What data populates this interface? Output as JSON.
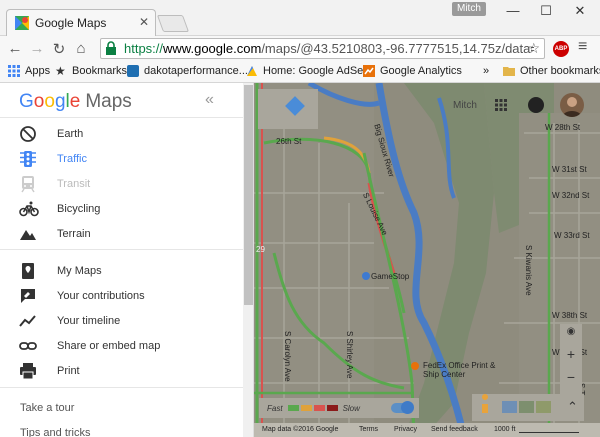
{
  "window": {
    "tab_title": "Google Maps",
    "user_badge": "Mitch",
    "controls": {
      "minimize": "—",
      "maximize": "☐",
      "close": "✕"
    }
  },
  "toolbar": {
    "url_scheme": "https://",
    "url_host": "www.google.com",
    "url_path": "/maps/@43.5210803,-96.7777515,14.75z/data=!5",
    "abp_label": "ABP"
  },
  "bookmarks": [
    {
      "label": "Apps",
      "icon": "apps-icon"
    },
    {
      "label": "Bookmarks",
      "icon": "star-icon"
    },
    {
      "label": "dakotaperformance...",
      "icon": "site-icon"
    },
    {
      "label": "Home: Google AdSe...",
      "icon": "adsense-icon"
    },
    {
      "label": "Google Analytics",
      "icon": "analytics-icon"
    },
    {
      "label": "Other bookmarks",
      "icon": "folder-icon"
    }
  ],
  "bookmarks_more": "»",
  "sidebar": {
    "brand_letters": [
      "G",
      "o",
      "o",
      "g",
      "l",
      "e"
    ],
    "brand_suffix": "Maps",
    "collapse": "«",
    "layers": [
      {
        "label": "Earth",
        "icon": "earth-icon",
        "state": "normal"
      },
      {
        "label": "Traffic",
        "icon": "traffic-icon",
        "state": "active"
      },
      {
        "label": "Transit",
        "icon": "transit-icon",
        "state": "disabled"
      },
      {
        "label": "Bicycling",
        "icon": "bicycle-icon",
        "state": "normal"
      },
      {
        "label": "Terrain",
        "icon": "terrain-icon",
        "state": "normal"
      }
    ],
    "personal": [
      {
        "label": "My Maps",
        "icon": "my-maps-icon"
      },
      {
        "label": "Your contributions",
        "icon": "contributions-icon"
      },
      {
        "label": "Your timeline",
        "icon": "timeline-icon"
      },
      {
        "label": "Share or embed map",
        "icon": "link-icon"
      },
      {
        "label": "Print",
        "icon": "print-icon"
      }
    ],
    "take_tour": "Take a tour",
    "tips": "Tips and tricks"
  },
  "map": {
    "user_name": "Mitch",
    "streets": {
      "w28": "W 28th St",
      "w26": "26th St",
      "big_sioux": "Big Sioux River",
      "s_louise": "S Louise Ave",
      "w31": "W 31st St",
      "w32": "W 32nd St",
      "w33": "W 33rd St",
      "s_kiwanis": "S Kiwanis Ave",
      "w38": "W 38th St",
      "w39": "W 39th St",
      "s_carolyn": "S Carolyn Ave",
      "s_shirley": "S Shirley Ave",
      "s_tav": "S Tav",
      "route29": "29"
    },
    "poi": {
      "gamestop": "GameStop",
      "fedex": "FedEx Office Print & Ship Center"
    },
    "traffic_fast": "Fast",
    "traffic_slow": "Slow",
    "traffic_colors": [
      "#5aa84e",
      "#e0a23b",
      "#d9534f",
      "#8b1a1a"
    ],
    "zoom_in": "+",
    "zoom_out": "−",
    "expand": "⌃",
    "footer": {
      "map_data": "Map data ©2016 Google",
      "terms": "Terms",
      "privacy": "Privacy",
      "feedback": "Send feedback",
      "scale": "1000 ft"
    }
  }
}
